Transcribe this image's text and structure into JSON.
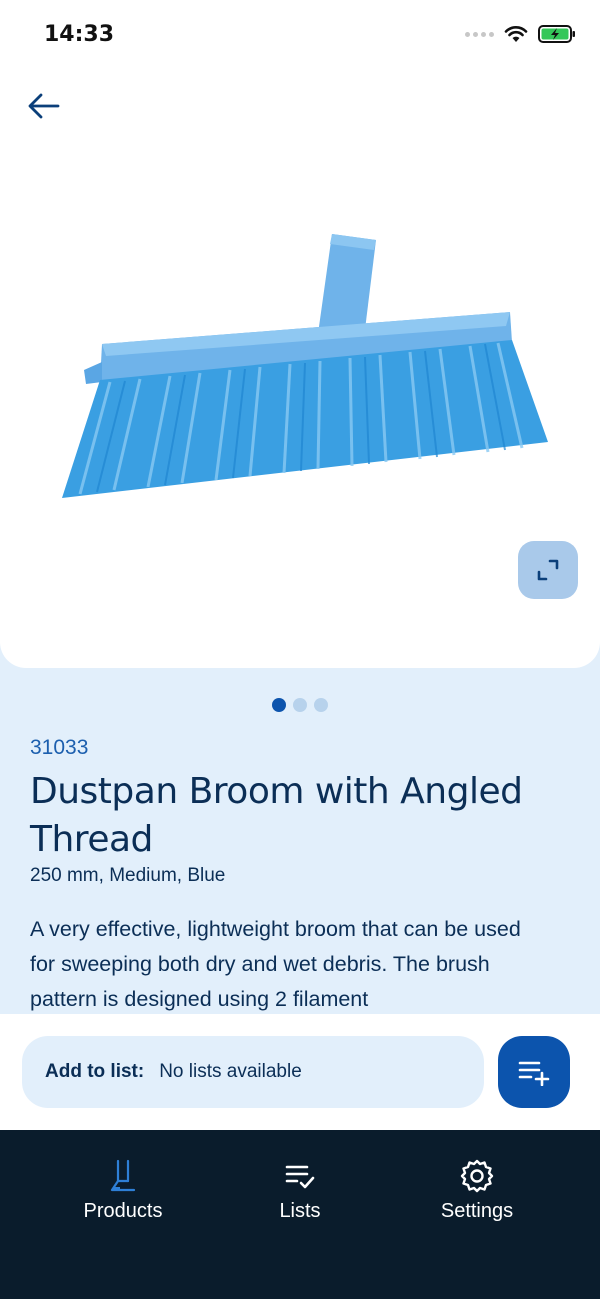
{
  "status": {
    "time": "14:33"
  },
  "product": {
    "sku": "31033",
    "title": "Dustpan Broom with Angled Thread",
    "variant": "250 mm, Medium, Blue",
    "description": "A very effective, lightweight broom that can be used for sweeping both dry and wet debris. The brush pattern is designed using 2 filament",
    "image_count": 3,
    "active_image": 1
  },
  "add_to_list": {
    "label": "Add to list:",
    "value": "No lists available"
  },
  "tabs": [
    {
      "label": "Products",
      "icon": "broom-icon",
      "active": true
    },
    {
      "label": "Lists",
      "icon": "list-check-icon",
      "active": false
    },
    {
      "label": "Settings",
      "icon": "gear-icon",
      "active": false
    }
  ],
  "colors": {
    "brand": "#0c54ad",
    "text": "#0b2e56",
    "background": "#e2effb",
    "tab_bar": "#0a1c2c",
    "broom": "#3aa0e0"
  }
}
